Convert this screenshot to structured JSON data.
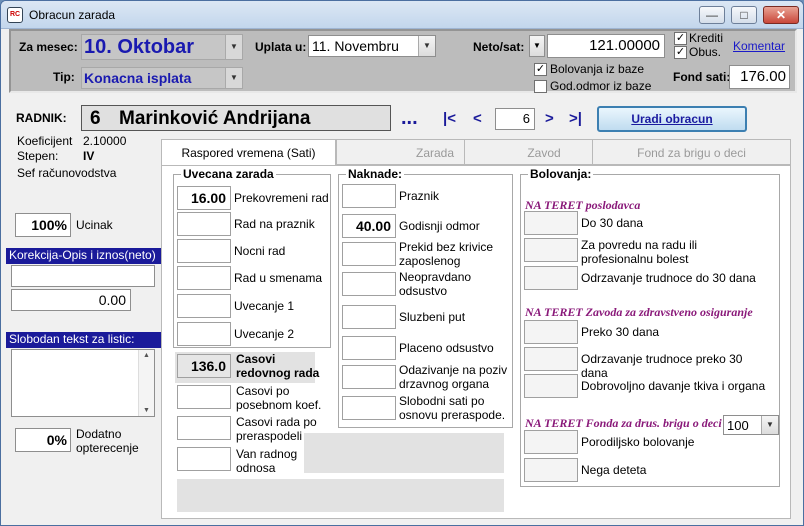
{
  "window": {
    "title": "Obracun zarada",
    "app_icon": "RC"
  },
  "header": {
    "za_mesec_label": "Za mesec:",
    "za_mesec_value": "10. Oktobar",
    "tip_label": "Tip:",
    "tip_value": "Konacna isplata",
    "uplata_label": "Uplata u:",
    "uplata_value": "11. Novembru",
    "neto_sat_label": "Neto/sat:",
    "neto_sat_value": "121.00000",
    "bolovanja_label": "Bolovanja iz baze",
    "bolovanja_checked": true,
    "god_odmor_label": "God.odmor iz baze",
    "god_odmor_checked": false,
    "krediti_label": "Krediti",
    "krediti_checked": true,
    "obus_label": "Obus.",
    "obus_checked": true,
    "komentar_link": "Komentar",
    "fond_sati_label": "Fond sati:",
    "fond_sati_value": "176.00"
  },
  "employee": {
    "radnik_label": "RADNIK:",
    "number": "6",
    "name": "Marinković Andrijana",
    "more": "...",
    "nav_first": "|<",
    "nav_prev": "<",
    "nav_value": "6",
    "nav_next": ">",
    "nav_last": ">|",
    "uradi_button": "Uradi obracun",
    "koeficijent_label": "Koeficijent",
    "koeficijent_value": "2.10000",
    "stepen_label": "Stepen:",
    "stepen_value": "IV",
    "role": "Sef računovodstva"
  },
  "left": {
    "ucinak_value": "100%",
    "ucinak_label": "Ucinak",
    "korekcija_header": "Korekcija-Opis i iznos(neto)",
    "korekcija_opis": "",
    "korekcija_iznos": "0.00",
    "slobodan_header": "Slobodan tekst za listic:",
    "dodatno_value": "0%",
    "dodatno_label": "Dodatno opterecenje"
  },
  "tabs": [
    {
      "label": "Raspored vremena (Sati)"
    },
    {
      "label": "Zarada"
    },
    {
      "label": "Zavod"
    },
    {
      "label": "Fond za brigu o deci"
    }
  ],
  "uvecana": {
    "title": "Uvecana zarada",
    "rows": [
      {
        "value": "16.00",
        "label": "Prekovremeni rad"
      },
      {
        "value": "",
        "label": "Rad na praznik"
      },
      {
        "value": "",
        "label": "Nocni rad"
      },
      {
        "value": "",
        "label": "Rad u smenama"
      },
      {
        "value": "",
        "label": "Uvecanje 1"
      },
      {
        "value": "",
        "label": "Uvecanje 2"
      }
    ]
  },
  "redovni": {
    "value": "136.0",
    "label": "Casovi redovnog rada",
    "posebni_label": "Casovi po posebnom koef.",
    "preraspodela_label": "Casovi rada po preraspodeli r.v.",
    "van_label": "Van radnog odnosa"
  },
  "naknade": {
    "title": "Naknade:",
    "rows": [
      {
        "value": "",
        "label": "Praznik"
      },
      {
        "value": "40.00",
        "label": "Godisnji odmor"
      },
      {
        "value": "",
        "label": "Prekid bez krivice zaposlenog"
      },
      {
        "value": "",
        "label": "Neopravdano odsustvo"
      },
      {
        "value": "",
        "label": "Sluzbeni put"
      },
      {
        "value": "",
        "label": "Placeno odsustvo"
      },
      {
        "value": "",
        "label": "Odazivanje na poziv drzavnog organa"
      },
      {
        "value": "",
        "label": "Slobodni sati po osnovu preraspode."
      }
    ]
  },
  "bolovanja": {
    "title": "Bolovanja:",
    "sections": [
      {
        "title": "NA TERET poslodavca",
        "items": [
          "Do 30 dana",
          "Za povredu na radu ili profesionalnu bolest",
          "Odrzavanje trudnoce do 30 dana"
        ]
      },
      {
        "title": "NA TERET Zavoda za zdravstveno osiguranje",
        "items": [
          "Preko 30 dana",
          "Odrzavanje trudnoce preko 30 dana",
          "Dobrovoljno davanje tkiva i organa"
        ]
      },
      {
        "title": "NA TERET Fonda za drus. brigu o deci",
        "items": [
          "Porodiljsko bolovanje",
          "Nega deteta"
        ],
        "percent": "100"
      }
    ]
  }
}
